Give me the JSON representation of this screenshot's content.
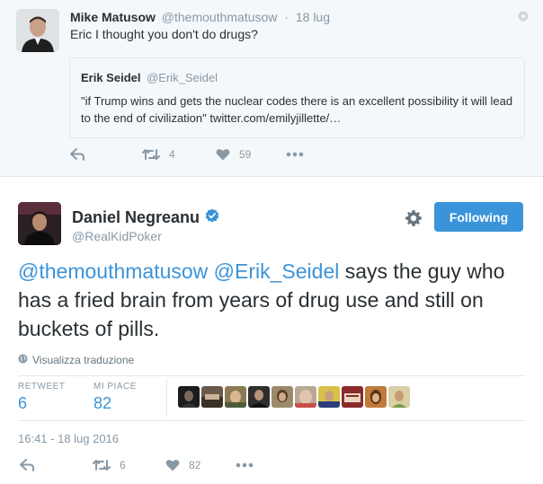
{
  "reply_tweet": {
    "fullname": "Mike Matusow",
    "username": "@themouthmatusow",
    "separator": "·",
    "time": "18 lug",
    "text": "Eric I thought you don't do drugs?",
    "quote": {
      "fullname": "Erik Seidel",
      "username": "@Erik_Seidel",
      "text": "\"if Trump wins and gets the nuclear codes there is an excellent possibility it will lead to the end of civilization\" twitter.com/emilyjillette/…"
    },
    "retweet_count": "4",
    "like_count": "59"
  },
  "main_tweet": {
    "fullname": "Daniel Negreanu",
    "username": "@RealKidPoker",
    "follow_label": "Following",
    "mention_1": "@themouthmatusow",
    "mention_2": "@Erik_Seidel",
    "text_rest": " says the guy who has a fried brain from years of drug use and still on buckets of pills.",
    "translate_label": "Visualizza traduzione",
    "retweets_label": "RETWEET",
    "retweets_value": "6",
    "likes_label": "MI PIACE",
    "likes_value": "82",
    "timestamp": "16:41 - 18 lug 2016",
    "retweet_count": "6",
    "like_count": "82"
  },
  "colors": {
    "accent": "#3b94d9",
    "muted": "#8899a6",
    "text": "#292f33",
    "reply_bg": "#f5f8fa",
    "border": "#e1e8ed"
  },
  "icons": [
    "geo-icon",
    "reply-icon",
    "retweet-icon",
    "heart-icon",
    "more-icon",
    "verified-icon",
    "gear-icon",
    "globe-icon"
  ],
  "likers": [
    "liker-1",
    "liker-2",
    "liker-3",
    "liker-4",
    "liker-5",
    "liker-6",
    "liker-7",
    "liker-8",
    "liker-9",
    "liker-10"
  ]
}
